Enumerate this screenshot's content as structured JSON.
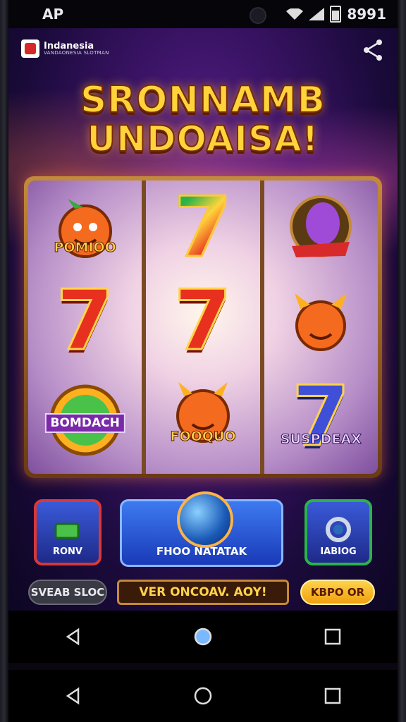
{
  "status_bar": {
    "carrier": "AP",
    "time": "8991"
  },
  "header": {
    "badge_title": "Indanesia",
    "badge_subtitle": "VANDAONESIA SLOTMAN",
    "title_line1": "SRONNAMB",
    "title_line2": "UNDOAISA!"
  },
  "reels": {
    "col1": {
      "top_label": "POMIOO",
      "bottom_label": "BOMDACH"
    },
    "col2": {
      "top_symbol": "7",
      "mid_symbol": "7",
      "bottom_label": "FOOQUO"
    },
    "col3": {
      "bottom_symbol": "7",
      "bottom_label": "SUSPDEAX"
    },
    "col1_mid_symbol": "7"
  },
  "controls": {
    "left_button_label": "RONV",
    "main_button_label": "FHOO NATATAK",
    "right_button_label": "IABIOG",
    "pill_left_label": "SVEAB SLOC",
    "pill_center_label": "VER ONCOAV. AOY!",
    "pill_right_label": "KBPO OR"
  },
  "colors": {
    "title_gold": "#ffd43b",
    "seven_red": "#e8301e",
    "main_blue": "#3d7af0",
    "frame_bronze": "#c48a3a"
  },
  "icons": [
    "wifi-icon",
    "signal-icon",
    "battery-icon",
    "share-icon",
    "back-icon",
    "home-icon",
    "recents-icon"
  ]
}
